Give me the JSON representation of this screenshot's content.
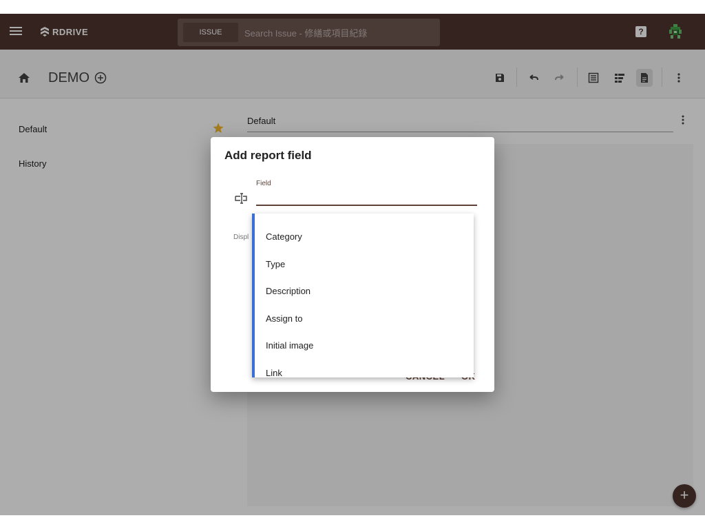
{
  "app": {
    "brand": "RDRIVE",
    "search": {
      "scope_label": "ISSUE",
      "placeholder": "Search Issue - 修繕或項目紀錄"
    },
    "help_label": "?"
  },
  "toolbar": {
    "project_title": "DEMO",
    "icons": [
      "home-icon",
      "add-circle-icon",
      "save-icon",
      "undo-icon",
      "redo-icon",
      "list-view-icon",
      "outline-view-icon",
      "document-icon",
      "more-vert-icon"
    ]
  },
  "sidebar": {
    "items": [
      {
        "label": "Default"
      },
      {
        "label": "History"
      }
    ]
  },
  "main": {
    "field_value": "Default"
  },
  "dialog": {
    "title": "Add report field",
    "field_label": "Field",
    "display_label": "Displ",
    "cancel_label": "CANCEL",
    "ok_label": "OK"
  },
  "dropdown": {
    "options": [
      "Category",
      "Type",
      "Description",
      "Assign to",
      "Initial image",
      "Link"
    ]
  },
  "fab_label": "+",
  "colors": {
    "topbar": "#4e342e",
    "accent": "#5d4037",
    "star": "#f5b82e",
    "dropdown_border": "#3b6fd1"
  }
}
